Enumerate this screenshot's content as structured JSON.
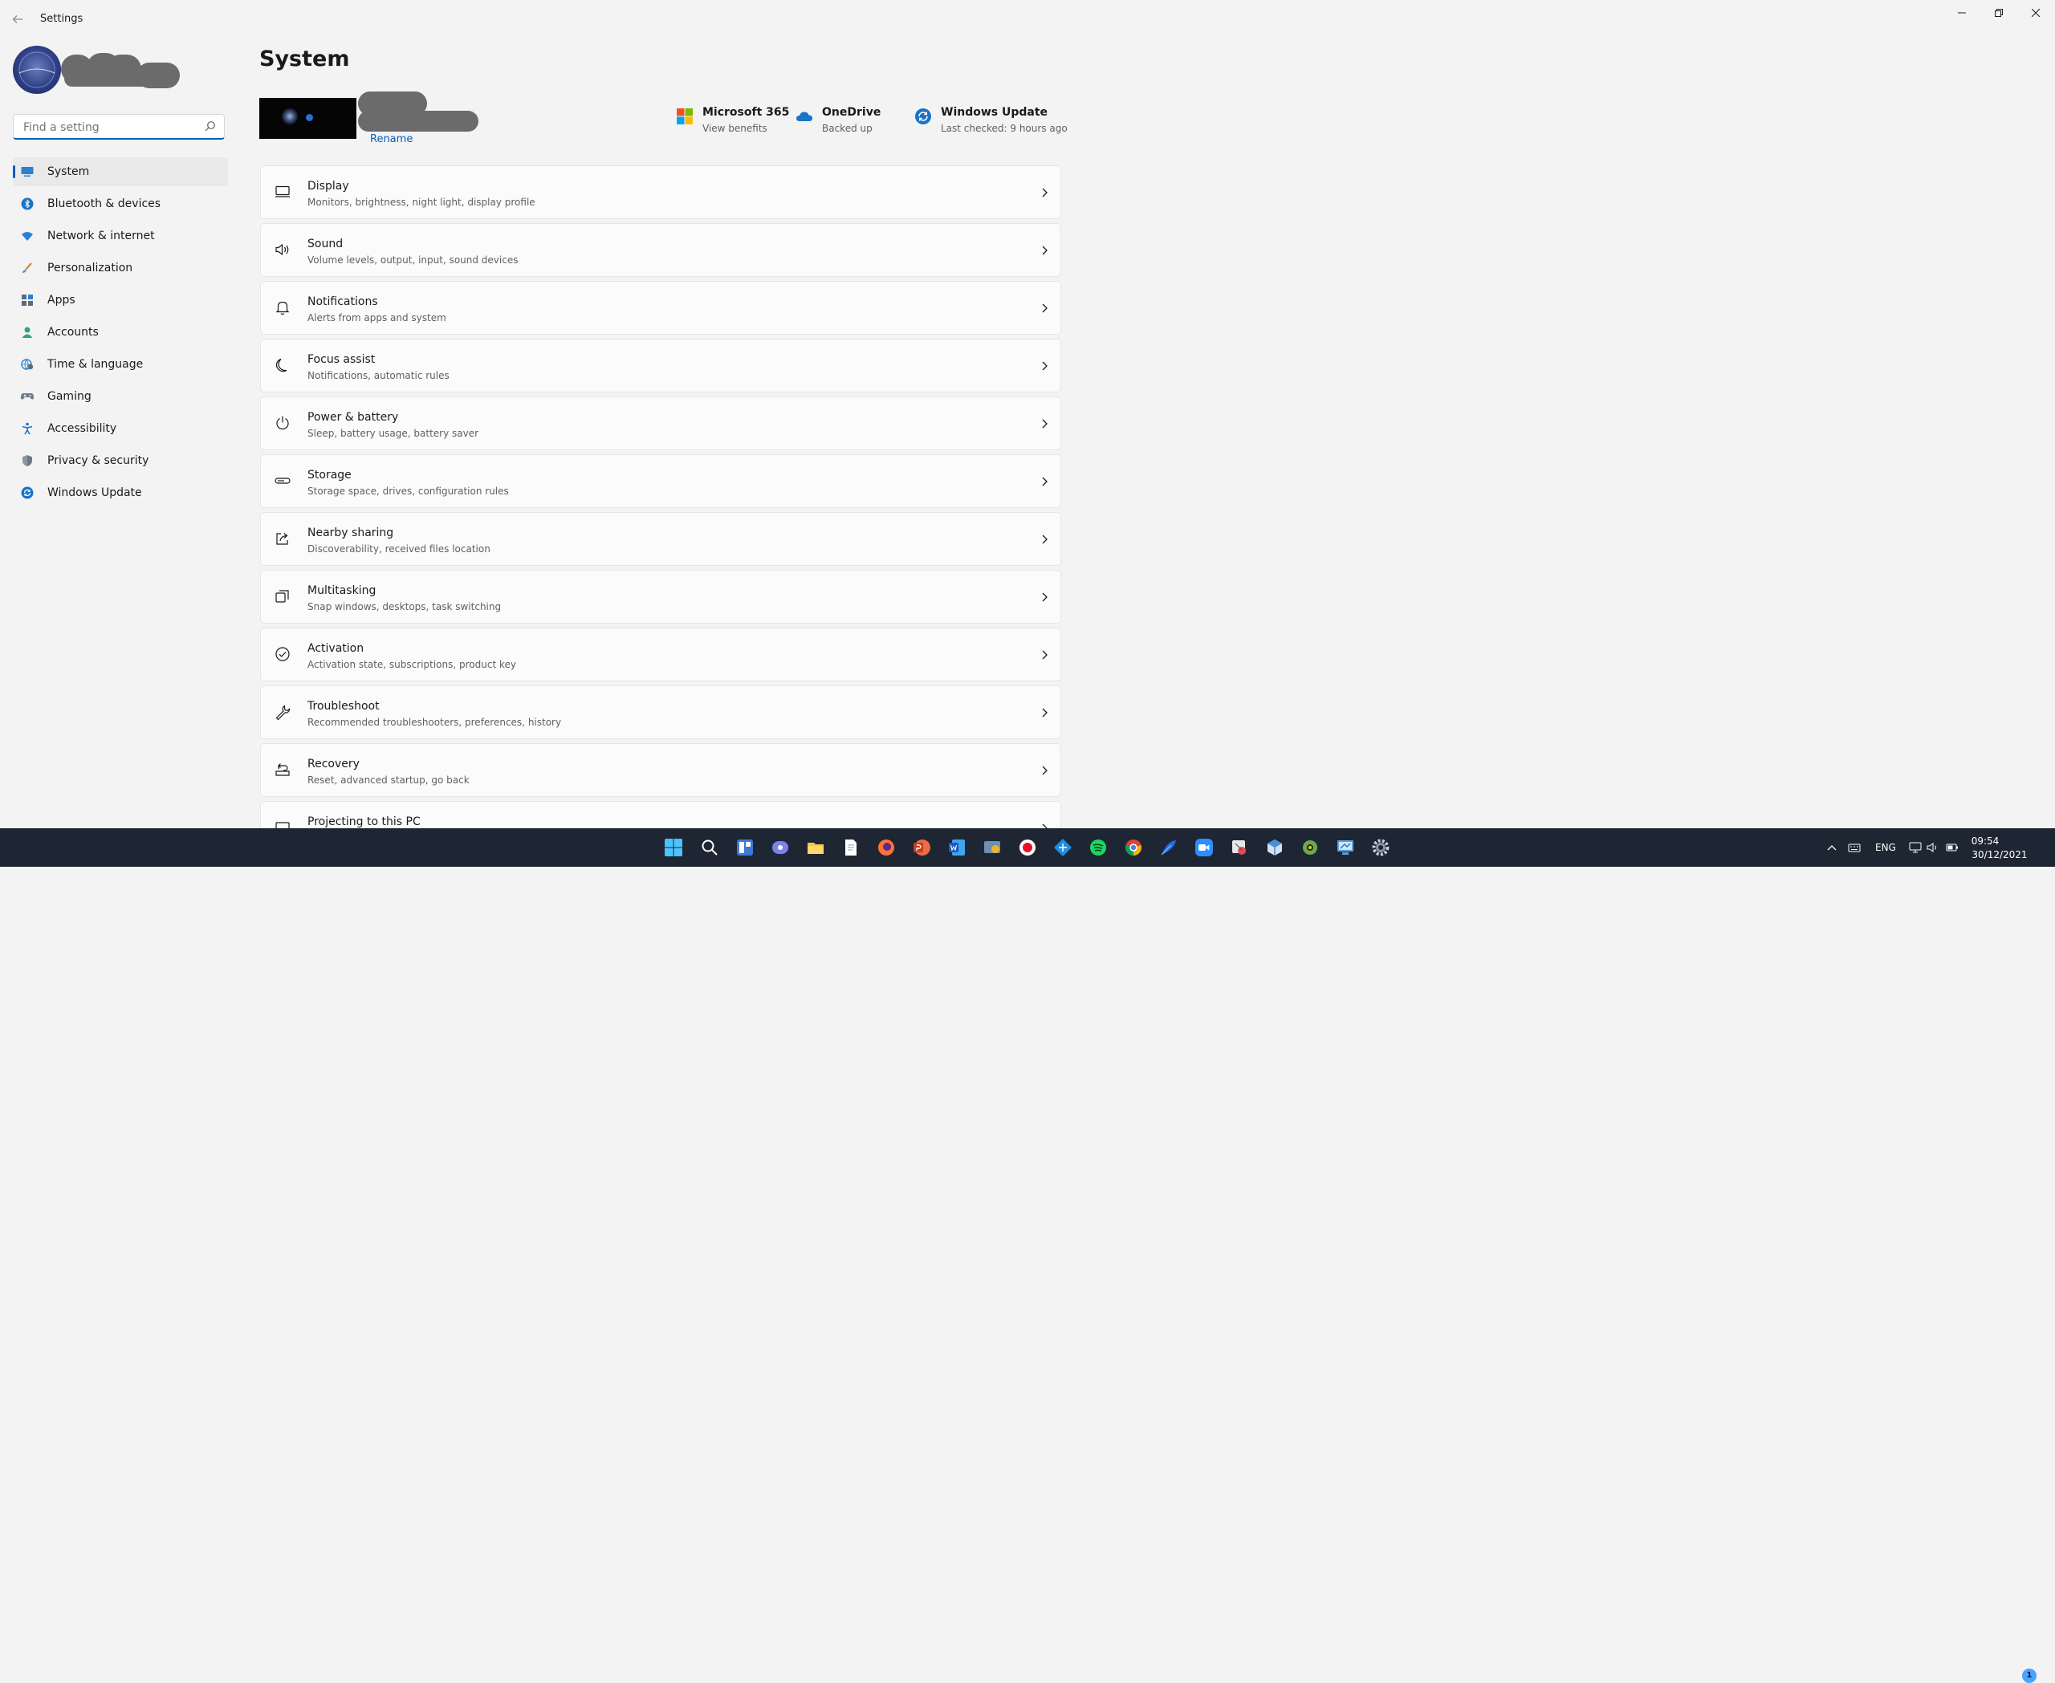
{
  "window": {
    "title": "Settings"
  },
  "sidebar": {
    "search": {
      "placeholder": "Find a setting",
      "value": ""
    },
    "items": [
      {
        "label": "System",
        "icon": "system-monitor-icon",
        "active": true
      },
      {
        "label": "Bluetooth & devices",
        "icon": "bluetooth-icon"
      },
      {
        "label": "Network & internet",
        "icon": "wifi-icon"
      },
      {
        "label": "Personalization",
        "icon": "paintbrush-icon"
      },
      {
        "label": "Apps",
        "icon": "apps-grid-icon"
      },
      {
        "label": "Accounts",
        "icon": "person-icon"
      },
      {
        "label": "Time & language",
        "icon": "globe-clock-icon"
      },
      {
        "label": "Gaming",
        "icon": "gamepad-icon"
      },
      {
        "label": "Accessibility",
        "icon": "accessibility-icon"
      },
      {
        "label": "Privacy & security",
        "icon": "shield-icon"
      },
      {
        "label": "Windows Update",
        "icon": "update-sync-icon"
      }
    ]
  },
  "main": {
    "title": "System",
    "device": {
      "rename_label": "Rename"
    },
    "tiles": [
      {
        "title": "Microsoft 365",
        "subtitle": "View benefits",
        "icon": "microsoft-365-icon"
      },
      {
        "title": "OneDrive",
        "subtitle": "Backed up",
        "icon": "onedrive-cloud-icon"
      },
      {
        "title": "Windows Update",
        "subtitle": "Last checked: 9 hours ago",
        "icon": "update-sync-icon"
      }
    ],
    "cards": [
      {
        "title": "Display",
        "subtitle": "Monitors, brightness, night light, display profile",
        "icon": "display-icon"
      },
      {
        "title": "Sound",
        "subtitle": "Volume levels, output, input, sound devices",
        "icon": "speaker-icon"
      },
      {
        "title": "Notifications",
        "subtitle": "Alerts from apps and system",
        "icon": "bell-icon"
      },
      {
        "title": "Focus assist",
        "subtitle": "Notifications, automatic rules",
        "icon": "moon-icon"
      },
      {
        "title": "Power & battery",
        "subtitle": "Sleep, battery usage, battery saver",
        "icon": "power-icon"
      },
      {
        "title": "Storage",
        "subtitle": "Storage space, drives, configuration rules",
        "icon": "storage-drive-icon"
      },
      {
        "title": "Nearby sharing",
        "subtitle": "Discoverability, received files location",
        "icon": "share-icon"
      },
      {
        "title": "Multitasking",
        "subtitle": "Snap windows, desktops, task switching",
        "icon": "multitasking-icon"
      },
      {
        "title": "Activation",
        "subtitle": "Activation state, subscriptions, product key",
        "icon": "check-circle-icon"
      },
      {
        "title": "Troubleshoot",
        "subtitle": "Recommended troubleshooters, preferences, history",
        "icon": "wrench-icon"
      },
      {
        "title": "Recovery",
        "subtitle": "Reset, advanced startup, go back",
        "icon": "recovery-icon"
      },
      {
        "title": "Projecting to this PC",
        "subtitle": "",
        "icon": "projection-icon"
      }
    ]
  },
  "taskbar": {
    "language": "ENG",
    "time": "09:54",
    "date": "30/12/2021",
    "notification_count": "1"
  },
  "colors": {
    "accent": "#005fb8",
    "window_bg": "#f3f3f3",
    "card_bg": "#fbfbfb",
    "taskbar_bg": "#1f2633"
  }
}
